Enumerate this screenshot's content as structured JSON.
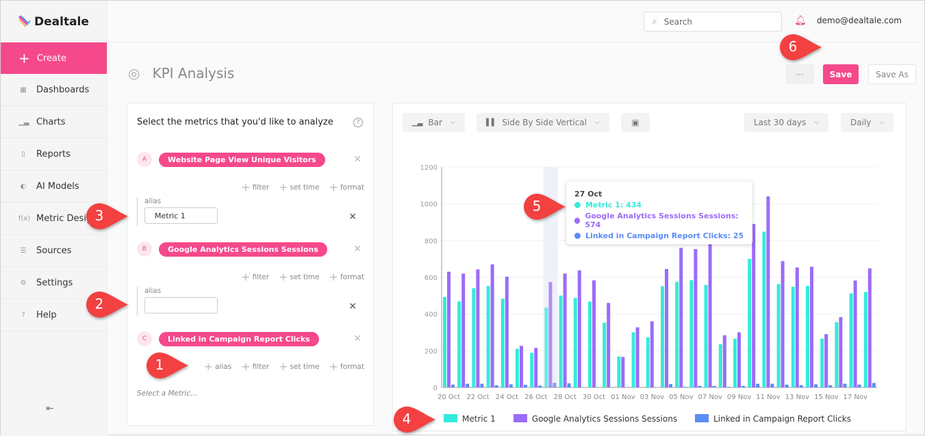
{
  "app": {
    "name": "Dealtale"
  },
  "sidebar": {
    "create_label": "Create",
    "items": [
      {
        "label": "Dashboards",
        "icon": "grid-icon"
      },
      {
        "label": "Charts",
        "icon": "bar-chart-icon"
      },
      {
        "label": "Reports",
        "icon": "document-icon"
      },
      {
        "label": "AI Models",
        "icon": "brain-icon"
      },
      {
        "label": "Metric Designer",
        "icon": "function-icon"
      },
      {
        "label": "Sources",
        "icon": "database-icon"
      },
      {
        "label": "Settings",
        "icon": "gear-icon"
      },
      {
        "label": "Help",
        "icon": "help-icon"
      }
    ]
  },
  "header": {
    "search_placeholder": "Search",
    "user": "demo@dealtale.com"
  },
  "page": {
    "title": "KPI Analysis",
    "more_label": "···",
    "save_label": "Save",
    "save_as_label": "Save As"
  },
  "metrics_panel": {
    "heading": "Select the metrics that you'd like to analyze",
    "metrics": [
      {
        "letter": "A",
        "name": "Website Page View Unique Visitors",
        "alias": "Metric 1"
      },
      {
        "letter": "B",
        "name": "Google Analytics Sessions Sessions",
        "alias": ""
      },
      {
        "letter": "C",
        "name": "Linked in Campaign Report Clicks"
      }
    ],
    "option_labels": {
      "alias": "alias",
      "filter": "filter",
      "set_time": "set time",
      "format": "format"
    },
    "alias_label": "alias",
    "select_placeholder": "Select a Metric..."
  },
  "toolbar": {
    "chart_type": "Bar",
    "layout": "Side By Side Vertical",
    "range": "Last 30 days",
    "granularity": "Daily"
  },
  "tooltip": {
    "date": "27 Oct",
    "rows": [
      "Metric 1: 434",
      "Google Analytics Sessions Sessions: 574",
      "Linked in Campaign Report Clicks: 25"
    ]
  },
  "callouts": [
    "1",
    "2",
    "3",
    "4",
    "5",
    "6"
  ],
  "chart_data": {
    "type": "bar",
    "ylim": [
      0,
      1200
    ],
    "yticks": [
      0,
      200,
      400,
      600,
      800,
      1000,
      1200
    ],
    "grid": true,
    "legend": "bottom",
    "categories": [
      "20 Oct",
      "21 Oct",
      "22 Oct",
      "23 Oct",
      "24 Oct",
      "25 Oct",
      "26 Oct",
      "27 Oct",
      "28 Oct",
      "29 Oct",
      "30 Oct",
      "31 Oct",
      "01 Nov",
      "02 Nov",
      "03 Nov",
      "04 Nov",
      "05 Nov",
      "06 Nov",
      "07 Nov",
      "08 Nov",
      "09 Nov",
      "10 Nov",
      "11 Nov",
      "12 Nov",
      "13 Nov",
      "14 Nov",
      "15 Nov",
      "16 Nov",
      "17 Nov",
      "18 Nov"
    ],
    "xtick_labels": [
      "20 Oct",
      "22 Oct",
      "24 Oct",
      "26 Oct",
      "28 Oct",
      "30 Oct",
      "01 Nov",
      "03 Nov",
      "05 Nov",
      "07 Nov",
      "09 Nov",
      "11 Nov",
      "13 Nov",
      "15 Nov",
      "17 Nov"
    ],
    "highlighted": "27 Oct",
    "series": [
      {
        "name": "Metric 1",
        "color": "#35eadb",
        "values": [
          492,
          468,
          540,
          553,
          483,
          210,
          188,
          434,
          500,
          487,
          467,
          352,
          168,
          300,
          272,
          551,
          575,
          584,
          558,
          235,
          265,
          700,
          848,
          562,
          548,
          553,
          265,
          355,
          512,
          520
        ]
      },
      {
        "name": "Google Analytics Sessions Sessions",
        "color": "#9b6cf7",
        "values": [
          630,
          620,
          643,
          670,
          603,
          226,
          215,
          574,
          620,
          637,
          583,
          460,
          166,
          327,
          360,
          645,
          760,
          753,
          780,
          284,
          300,
          890,
          1040,
          688,
          653,
          657,
          290,
          383,
          582,
          648
        ]
      },
      {
        "name": "Linked in Campaign Report Clicks",
        "color": "#5b8cf5",
        "values": [
          15,
          20,
          20,
          12,
          17,
          14,
          10,
          25,
          22,
          0,
          0,
          0,
          0,
          0,
          0,
          18,
          3,
          8,
          8,
          3,
          8,
          20,
          20,
          15,
          12,
          17,
          12,
          20,
          15,
          24
        ]
      }
    ]
  }
}
